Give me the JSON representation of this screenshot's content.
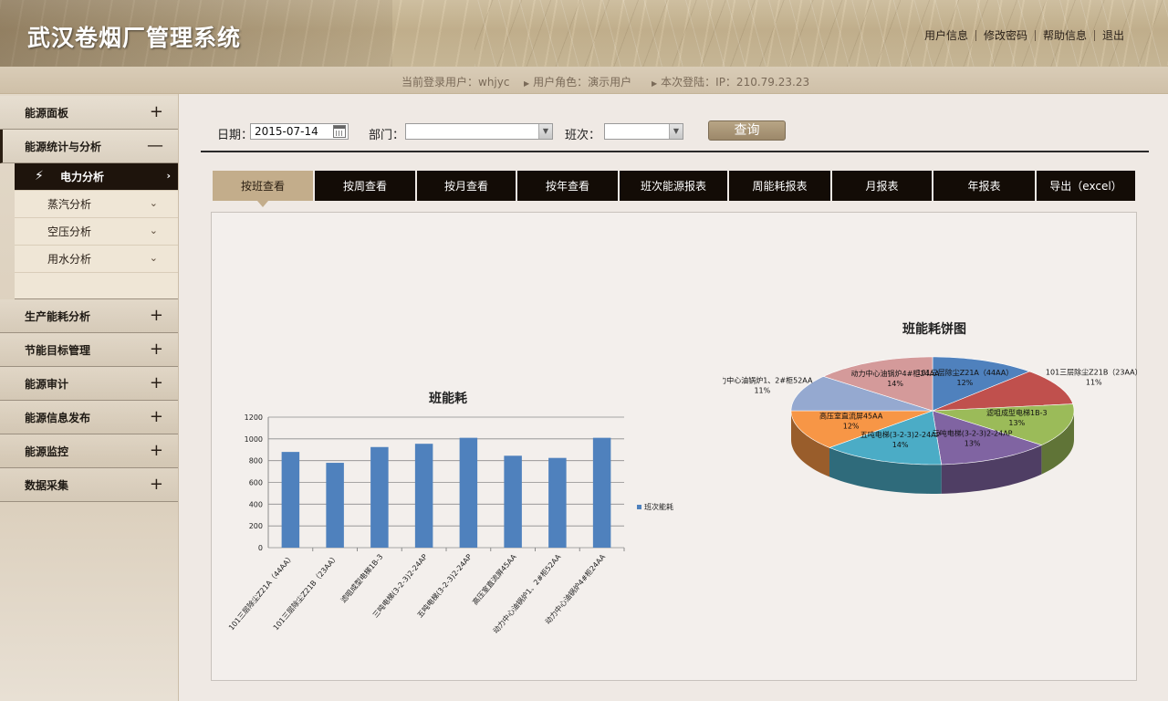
{
  "header": {
    "title": "武汉卷烟厂管理系统",
    "links": [
      "用户信息",
      "修改密码",
      "帮助信息",
      "退出"
    ]
  },
  "info_bar": {
    "user": "当前登录用户：whjyc",
    "role": "用户角色：演示用户",
    "login": "本次登陆：IP：210.79.23.23"
  },
  "sidebar": {
    "items": [
      {
        "label": "能源面板",
        "toggle": "+"
      },
      {
        "label": "能源统计与分析",
        "toggle": "—"
      },
      {
        "label": "生产能耗分析",
        "toggle": "+"
      },
      {
        "label": "节能目标管理",
        "toggle": "+"
      },
      {
        "label": "能源审计",
        "toggle": "+"
      },
      {
        "label": "能源信息发布",
        "toggle": "+"
      },
      {
        "label": "能源监控",
        "toggle": "+"
      },
      {
        "label": "数据采集",
        "toggle": "+"
      }
    ],
    "sub_items": [
      {
        "label": "电力分析",
        "chev": "›"
      },
      {
        "label": "蒸汽分析",
        "chev": "⌄"
      },
      {
        "label": "空压分析",
        "chev": "⌄"
      },
      {
        "label": "用水分析",
        "chev": "⌄"
      }
    ]
  },
  "filters": {
    "date_label": "日期：",
    "date_value": "2015-07-14",
    "dept_label": "部门：",
    "dept_value": "",
    "shift_label": "班次：",
    "shift_value": "",
    "query_label": "查询"
  },
  "tabs": [
    "按班查看",
    "按周查看",
    "按月查看",
    "按年查看",
    "班次能源报表",
    "周能耗报表",
    "月报表",
    "年报表",
    "导出（excel）"
  ],
  "chart_data": [
    {
      "type": "bar",
      "title": "班能耗",
      "categories": [
        "101三层除尘Z21A（44AA）",
        "101三层除尘Z21B（23AA）",
        "滤咀成型电梯1B-3",
        "三吨电梯(3-2-3)2-24AP",
        "五吨电梯(3-2-3)2-24AP",
        "高压室直流屏45AA",
        "动力中心油锅炉1、2#柜52AA",
        "动力中心油锅炉4#柜24AA"
      ],
      "series": [
        {
          "name": "班次能耗",
          "values": [
            880,
            780,
            925,
            955,
            1010,
            845,
            825,
            1010
          ]
        }
      ],
      "ylim": [
        0,
        1200
      ],
      "yticks": [
        0,
        200,
        400,
        600,
        800,
        1000,
        1200
      ],
      "grid": true,
      "legend": "right",
      "color": "#4f81bd"
    },
    {
      "type": "pie",
      "title": "班能耗饼图",
      "slices": [
        {
          "label": "101三层除尘Z21A（44AA）",
          "pct": "12%",
          "value": 12,
          "color": "#4f81bd"
        },
        {
          "label": "101三层除尘Z21B（23AA）",
          "pct": "11%",
          "value": 11,
          "color": "#c0504d"
        },
        {
          "label": "滤咀成型电梯1B-3",
          "pct": "13%",
          "value": 13,
          "color": "#9bbb59"
        },
        {
          "label": "三吨电梯(3-2-3)2-24AP",
          "pct": "13%",
          "value": 13,
          "color": "#8064a2"
        },
        {
          "label": "五吨电梯(3-2-3)2-24AP",
          "pct": "14%",
          "value": 14,
          "color": "#4bacc6"
        },
        {
          "label": "高压室直流屏45AA",
          "pct": "12%",
          "value": 12,
          "color": "#f79646"
        },
        {
          "label": "动力中心油锅炉1、2#柜52AA",
          "pct": "11%",
          "value": 11,
          "color": "#95a9d0"
        },
        {
          "label": "动力中心油锅炉4#柜24AA",
          "pct": "14%",
          "value": 14,
          "color": "#d49a9a"
        }
      ]
    }
  ]
}
